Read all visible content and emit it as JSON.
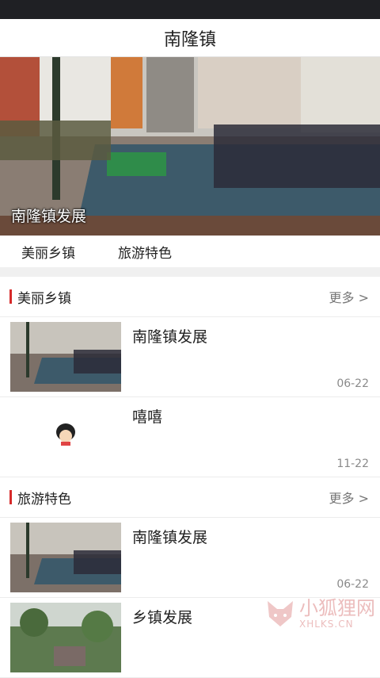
{
  "app": {
    "title": "南隆镇"
  },
  "banner": {
    "caption": "南隆镇发展"
  },
  "tabs": [
    {
      "label": "美丽乡镇"
    },
    {
      "label": "旅游特色"
    }
  ],
  "sections": [
    {
      "title": "美丽乡镇",
      "more": "更多 >",
      "items": [
        {
          "title": "南隆镇发展",
          "date": "06-22"
        },
        {
          "title": "嘻嘻",
          "date": "11-22"
        }
      ]
    },
    {
      "title": "旅游特色",
      "more": "更多 >",
      "items": [
        {
          "title": "南隆镇发展",
          "date": "06-22"
        },
        {
          "title": "乡镇发展",
          "date": ""
        }
      ]
    }
  ],
  "watermark": {
    "cn": "小狐狸网",
    "en": "XHLKS.CN"
  },
  "colors": {
    "accent": "#d62b2b",
    "statusbar": "#1f2024"
  }
}
